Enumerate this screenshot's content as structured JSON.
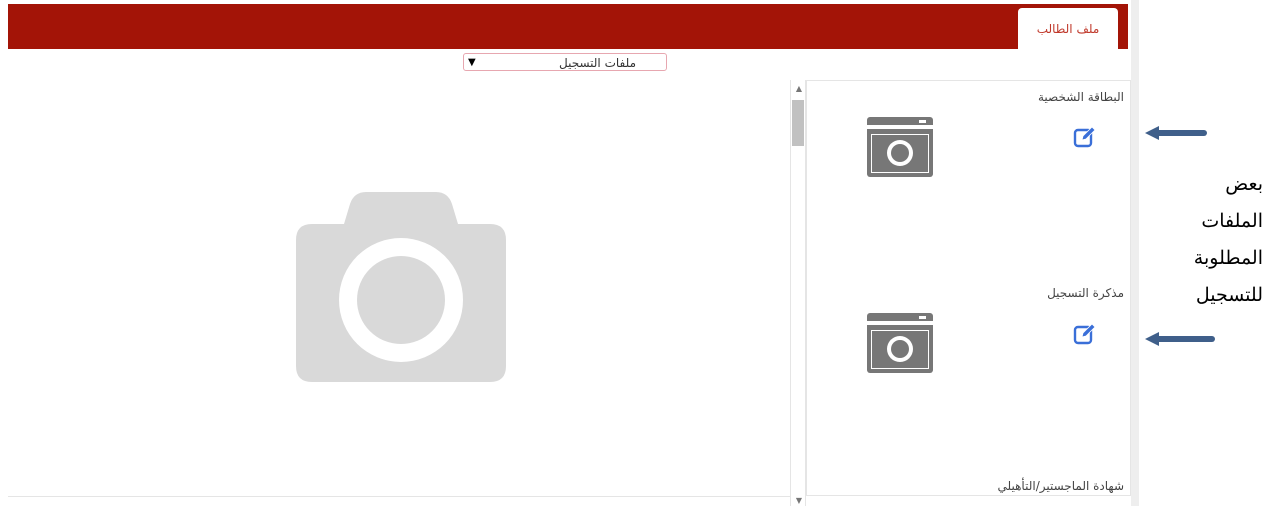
{
  "header": {
    "tab_label": "ملف الطالب"
  },
  "file_select": {
    "selected": "ملفات التسجيل",
    "arrow": "▼"
  },
  "documents": [
    {
      "label": "البطاقة الشخصية",
      "icon": "camera-icon",
      "action_icon": "edit-icon"
    },
    {
      "label": "مذكرة التسجيل",
      "icon": "camera-icon",
      "action_icon": "edit-icon"
    },
    {
      "label": "شهادة الماجستير/التأهيلي"
    }
  ],
  "preview": {
    "icon": "camera-icon"
  },
  "annotation": {
    "lines": [
      "بعض",
      "الملفات",
      "المطلوبة",
      "للتسجيل"
    ]
  },
  "colors": {
    "brand_red": "#a31407",
    "edit_blue": "#3a6fd8",
    "arrow_blue": "#3f5f8a",
    "camera_gray": "#777777",
    "placeholder_gray": "#d9d9d9"
  }
}
